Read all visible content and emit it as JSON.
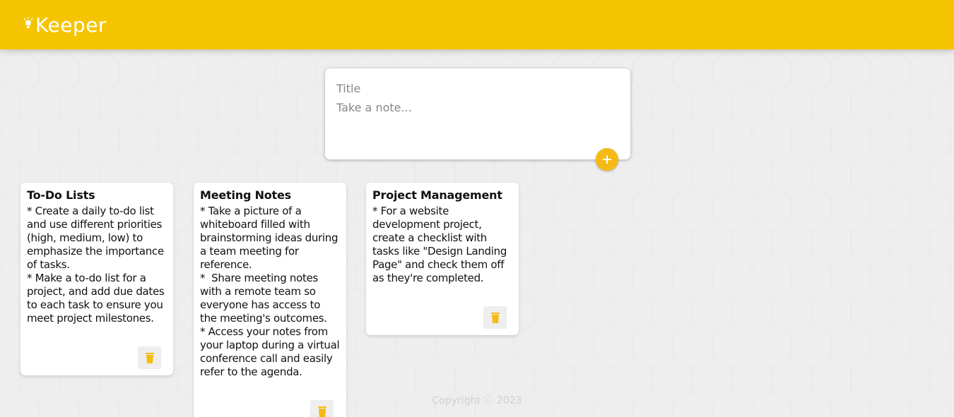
{
  "header": {
    "app_name": "Keeper"
  },
  "create_note": {
    "title_placeholder": "Title",
    "content_placeholder": "Take a note..."
  },
  "notes": [
    {
      "title": "To-Do Lists",
      "content": "* Create a daily to-do list and use different priorities (high, medium, low) to emphasize the importance of tasks.\n* Make a to-do list for a project, and add due dates to each task to ensure you meet project milestones."
    },
    {
      "title": "Meeting Notes",
      "content": "* Take a picture of a whiteboard filled with brainstorming ideas during a team meeting for reference.\n*  Share meeting notes with a remote team so everyone has access to the meeting's outcomes.\n* Access your notes from your laptop during a virtual conference call and easily refer to the agenda."
    },
    {
      "title": "Project Management",
      "content": "* For a website development project, create a checklist with tasks like \"Design Landing Page\" and check them off as they're completed."
    }
  ],
  "footer": {
    "copyright": "Copyright ⓒ 2023"
  },
  "colors": {
    "brand": "#f5c400",
    "accent": "#f5ba13"
  },
  "icons": {
    "logo": "lightbulb-icon",
    "add": "add-icon",
    "delete": "delete-icon"
  }
}
